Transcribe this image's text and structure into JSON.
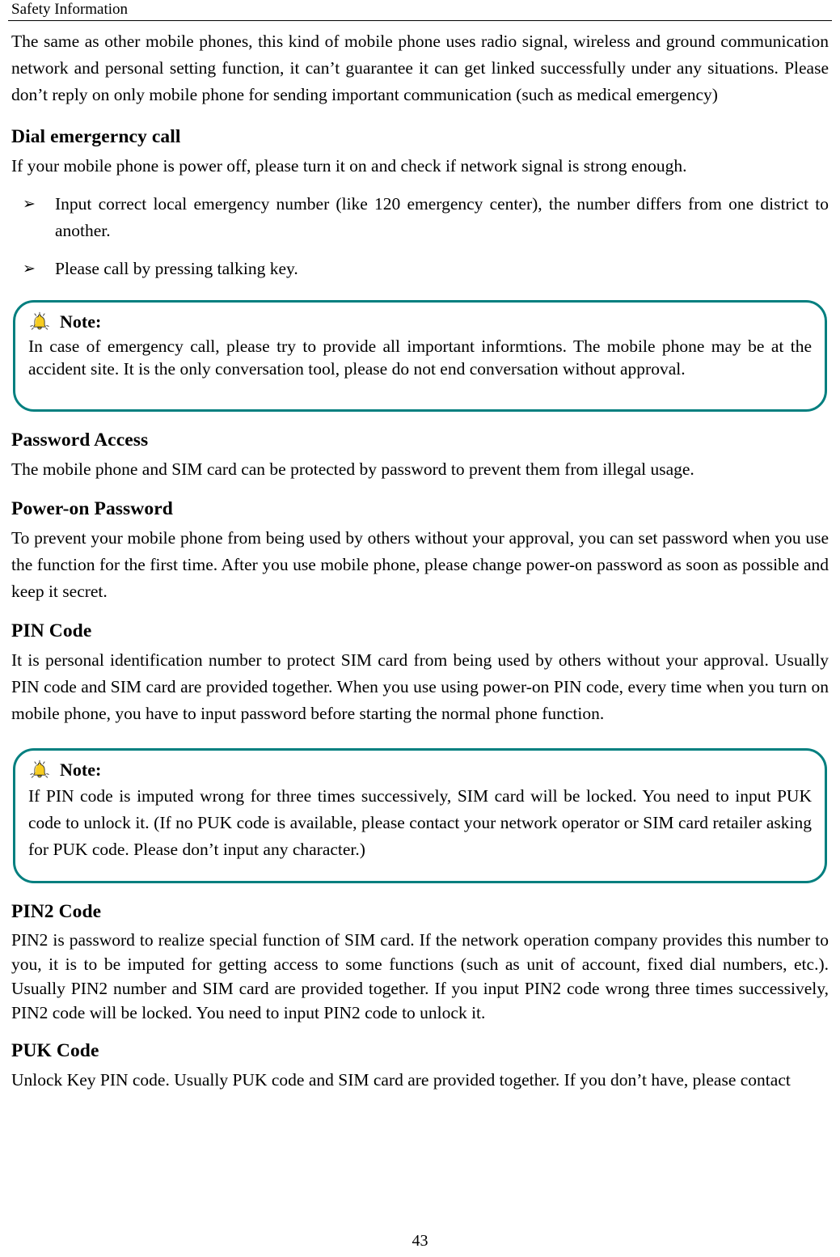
{
  "document": {
    "running_header": "Safety Information",
    "page_number": "43"
  },
  "intro_paragraph": "The same as other mobile phones, this kind of mobile phone uses radio signal, wireless and ground communication network and personal setting function, it can’t guarantee it can get linked successfully under any situations. Please don’t reply on only mobile phone for sending important communication (such as medical emergency)",
  "sections": {
    "dial_emergency": {
      "heading": "Dial emergerncy call",
      "paragraph": "If your mobile phone is power off, please turn it on and check if network signal is strong enough.",
      "bullets": [
        {
          "marker": "➢",
          "text": "Input correct local emergency number (like 120 emergency center), the number differs from one district to another."
        },
        {
          "marker": "➢",
          "text": "Please call by pressing talking key."
        }
      ]
    },
    "note_emergency": {
      "icon": "bell-icon",
      "title": "Note:",
      "body": "In case of emergency call, please try to provide all important informtions. The mobile phone may be at the accident site. It is the only conversation tool, please do not end conversation without approval."
    },
    "password_access": {
      "heading": "Password Access",
      "paragraph": "The mobile phone and SIM card can be protected by password to prevent them from illegal usage."
    },
    "power_on_password": {
      "heading": "Power-on Password",
      "paragraph": "To prevent your mobile phone from being used by others without your approval, you can set password when you use the function for the first time. After you use mobile phone, please change power-on password as soon as possible and keep it secret."
    },
    "pin_code": {
      "heading": "PIN Code",
      "paragraph": "It is personal identification number to protect SIM card from being used by others without your approval. Usually PIN code and SIM card are provided together. When you use using power-on PIN code, every time when you turn on mobile phone, you have to input password before starting the normal phone function."
    },
    "note_pin": {
      "icon": "bell-icon",
      "title": "Note:",
      "body": "If PIN code is imputed wrong for three times successively, SIM card will be locked. You need to input PUK code to unlock it. (If no PUK code is available, please contact your network operator or SIM card retailer asking for PUK code. Please don’t input any character.)"
    },
    "pin2_code": {
      "heading": "PIN2 Code",
      "paragraph": "PIN2 is password to realize special function of SIM card. If the network operation company provides this number to you, it is to be imputed for getting access to some functions (such as unit of account, fixed dial numbers, etc.). Usually PIN2 number and SIM card are provided together. If you input PIN2 code wrong three times successively, PIN2 code will be locked. You need to input PIN2 code to unlock it."
    },
    "puk_code": {
      "heading": "PUK Code",
      "paragraph": "Unlock Key PIN code. Usually PUK code and SIM card are provided together. If you don’t have, please contact"
    }
  },
  "colors": {
    "note_border": "#017f7f",
    "bell_body": "#f5c518",
    "bell_outline": "#3a3a3a",
    "text": "#000000"
  }
}
